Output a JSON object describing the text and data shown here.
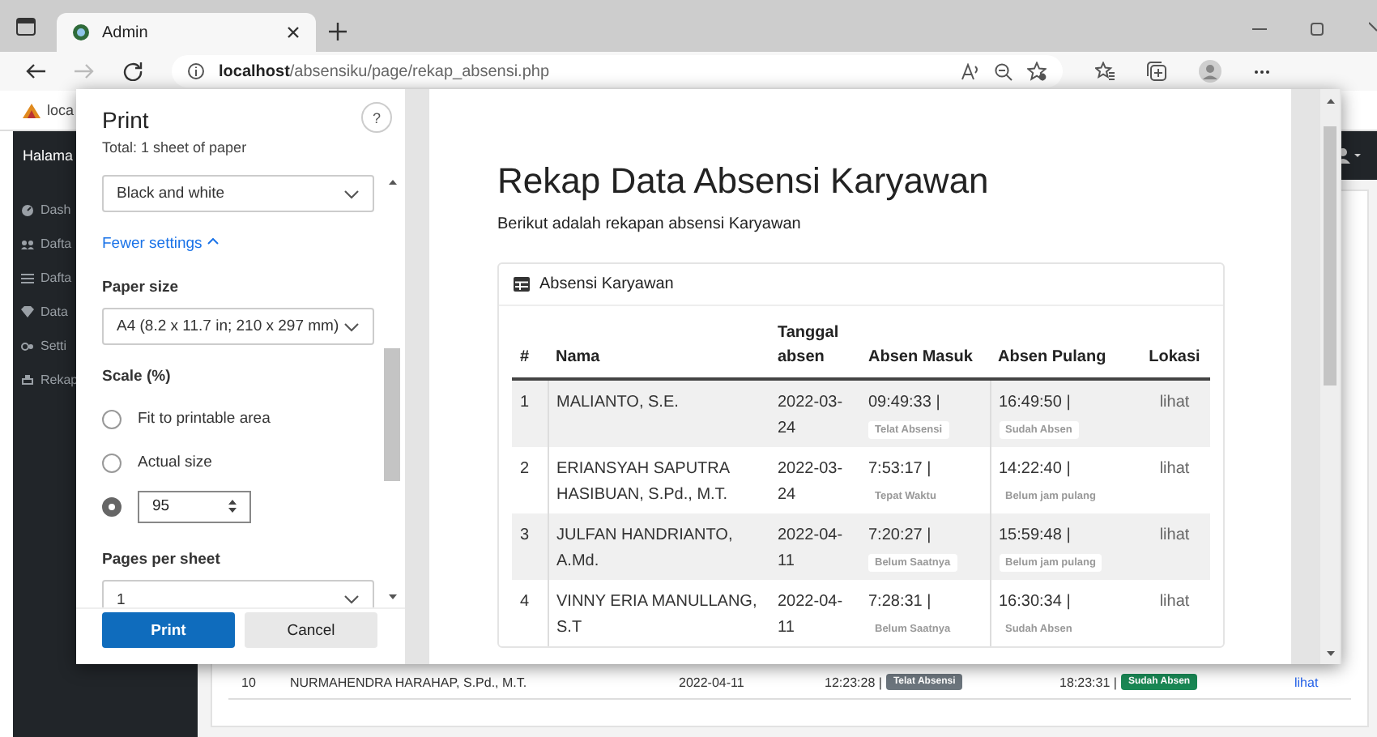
{
  "browser": {
    "tab": {
      "title": "Admin"
    },
    "url": "**localhost**/absensiku/page/rekap_absensi.php",
    "forward": {
      "disabled": true
    },
    "bookmark": "loca"
  },
  "app": {
    "brand": "Halama",
    "sidebar": [
      {
        "label": "Dash"
      },
      {
        "label": "Dafta"
      },
      {
        "label": "Dafta"
      },
      {
        "label": "Data"
      },
      {
        "label": "Setti"
      },
      {
        "label": "Rekap"
      }
    ],
    "background_row": {
      "no": "10",
      "name": "NURMAHENDRA HARAHAP, S.Pd., M.T.",
      "date": "2022-04-11",
      "in_time": "12:23:28 |",
      "in_badge": {
        "text": "Telat Absensi",
        "color": "#6c757d"
      },
      "out_time": "18:23:31 |",
      "out_badge": {
        "text": "Sudah Absen",
        "color": "#198754"
      },
      "location": "lihat"
    }
  },
  "print_dialog": {
    "title": "Print",
    "total": "Total: 1 sheet of paper",
    "help": "?",
    "color_select": "Black and white",
    "fewer_settings": "Fewer settings",
    "paper_size_label": "Paper size",
    "paper_size": "A4 (8.2 x 11.7 in; 210 x 297 mm)",
    "scale_label": "Scale (%)",
    "scale_options": [
      {
        "kind": "radio",
        "label": "Fit to printable area",
        "selected": false
      },
      {
        "kind": "radio",
        "label": "Actual size",
        "selected": false
      },
      {
        "kind": "custom",
        "value": "95",
        "selected": true
      }
    ],
    "pages_per_sheet_label": "Pages per sheet",
    "pages_per_sheet": "1",
    "buttons": [
      {
        "label": "Print",
        "kind": "primary"
      },
      {
        "label": "Cancel",
        "kind": "secondary"
      }
    ]
  },
  "preview": {
    "title": "Rekap Data Absensi Karyawan",
    "subtitle": "Berikut adalah rekapan absensi Karyawan",
    "card_title": "Absensi Karyawan",
    "columns": [
      "#",
      "Nama",
      "Tanggal absen",
      "Absen Masuk",
      "Absen Pulang",
      "Lokasi"
    ],
    "rows": [
      {
        "no": "1",
        "name": "MALIANTO, S.E.",
        "date": "2022-03-24",
        "in_time": "09:49:33 |",
        "in_badge": "Telat Absensi",
        "out_time": "16:49:50 |",
        "out_badge": "Sudah Absen",
        "location": "lihat"
      },
      {
        "no": "2",
        "name": "ERIANSYAH SAPUTRA HASIBUAN, S.Pd., M.T.",
        "date": "2022-03-24",
        "in_time": "7:53:17 |",
        "in_badge": "Tepat Waktu",
        "out_time": "14:22:40 |",
        "out_badge": "Belum jam pulang",
        "location": "lihat"
      },
      {
        "no": "3",
        "name": "JULFAN HANDRIANTO, A.Md.",
        "date": "2022-04-11",
        "in_time": "7:20:27 |",
        "in_badge": "Belum Saatnya",
        "out_time": "15:59:48 |",
        "out_badge": "Belum jam pulang",
        "location": "lihat"
      },
      {
        "no": "4",
        "name": "VINNY ERIA MANULLANG, S.T",
        "date": "2022-04-11",
        "in_time": "7:28:31 |",
        "in_badge": "Belum Saatnya",
        "out_time": "16:30:34 |",
        "out_badge": "Sudah Absen",
        "location": "lihat"
      }
    ]
  }
}
